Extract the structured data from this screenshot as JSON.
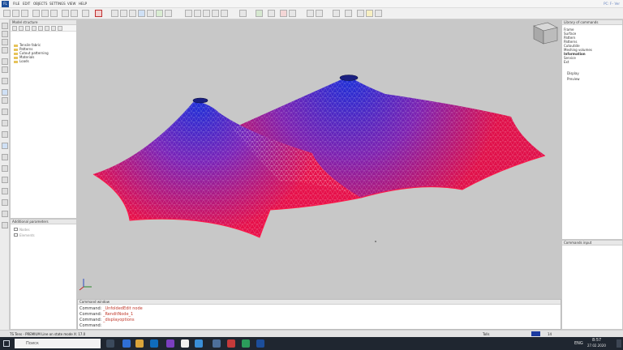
{
  "menubar": {
    "logo": "FL",
    "items": [
      "FILE",
      "EDIT",
      "OBJECTS",
      "SETTINGS",
      "VIEW",
      "HELP"
    ],
    "right": "PC: F– Ver"
  },
  "tree_panel": {
    "title": "Model structure",
    "items": [
      "Tensile fabric",
      "Patterns",
      "Cutout patterning",
      "Materials",
      "Loads"
    ]
  },
  "analysis_panel": {
    "title": "Additional parameters",
    "items": [
      "Nodes",
      "Elements"
    ]
  },
  "right_panel": {
    "title": "Library of commands",
    "items": [
      "Frame",
      "Surface",
      "Pattern",
      "Patterns",
      "Cutoutide",
      "Meshing volumes",
      "Information",
      "Service",
      "Ext"
    ],
    "sub_items": [
      "Display",
      "Preview"
    ]
  },
  "right_lower_panel": {
    "title": "Commands input"
  },
  "command_window": {
    "title": "Command window",
    "lines": [
      {
        "prefix": "Command:",
        "value": "_UnfoldedEdit node"
      },
      {
        "prefix": "Command:",
        "value": "_RenditNode_1"
      },
      {
        "prefix": "Command:",
        "value": "_displayoptions"
      },
      {
        "prefix": "Command:",
        "value": ""
      }
    ]
  },
  "statusbar": {
    "left": "TS Tens - PREMIUM  Line on state mode  X: 17.0",
    "right_label": "Tolls",
    "zoom": "14"
  },
  "taskbar": {
    "search_placeholder": "Поиск",
    "lang": "ENG",
    "time": "8:57",
    "date": "27.02.2020"
  },
  "viewport": {
    "mesh_colors": [
      "#2233cc",
      "#e0104a"
    ]
  }
}
